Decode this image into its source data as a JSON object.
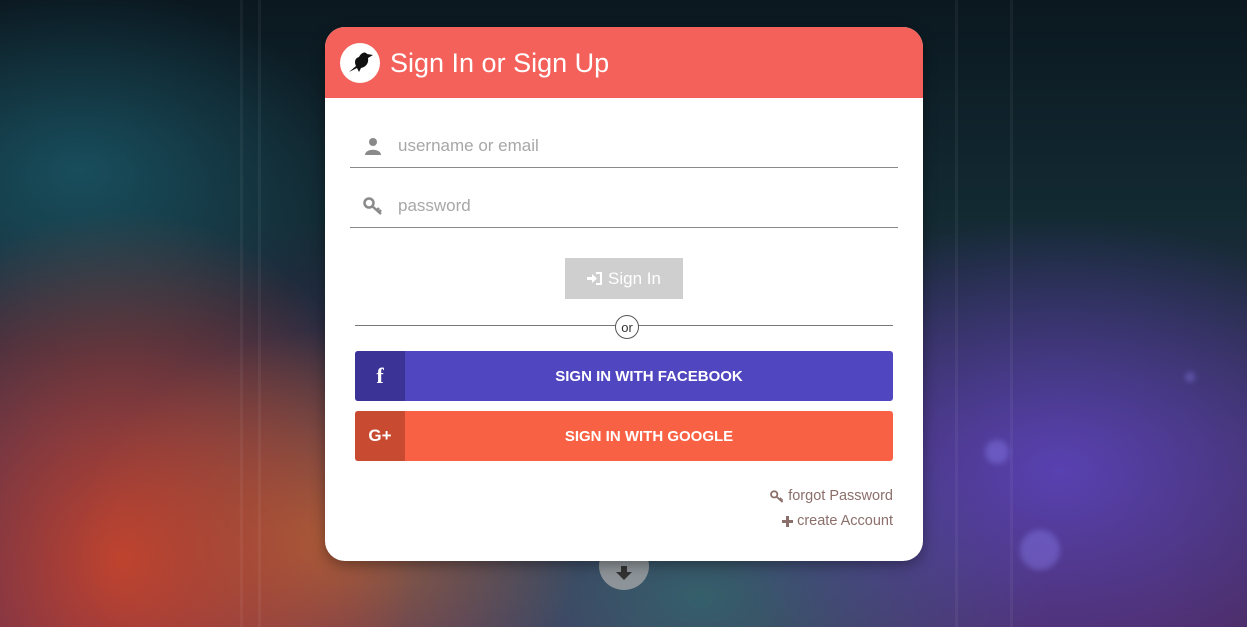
{
  "header": {
    "title": "Sign In or Sign Up"
  },
  "form": {
    "username_placeholder": "username or email",
    "password_placeholder": "password",
    "signin_label": "Sign In",
    "divider_text": "or"
  },
  "social": {
    "facebook_label": "SIGN IN WITH FACEBOOK",
    "facebook_icon_text": "f",
    "google_label": "SIGN IN WITH GOOGLE",
    "google_icon_text": "G+"
  },
  "links": {
    "forgot_password": "forgot Password",
    "create_account": "create Account"
  },
  "colors": {
    "header": "#f4615b",
    "facebook": "#5046c0",
    "google": "#f96145",
    "signin_disabled": "#cfcfcf"
  }
}
